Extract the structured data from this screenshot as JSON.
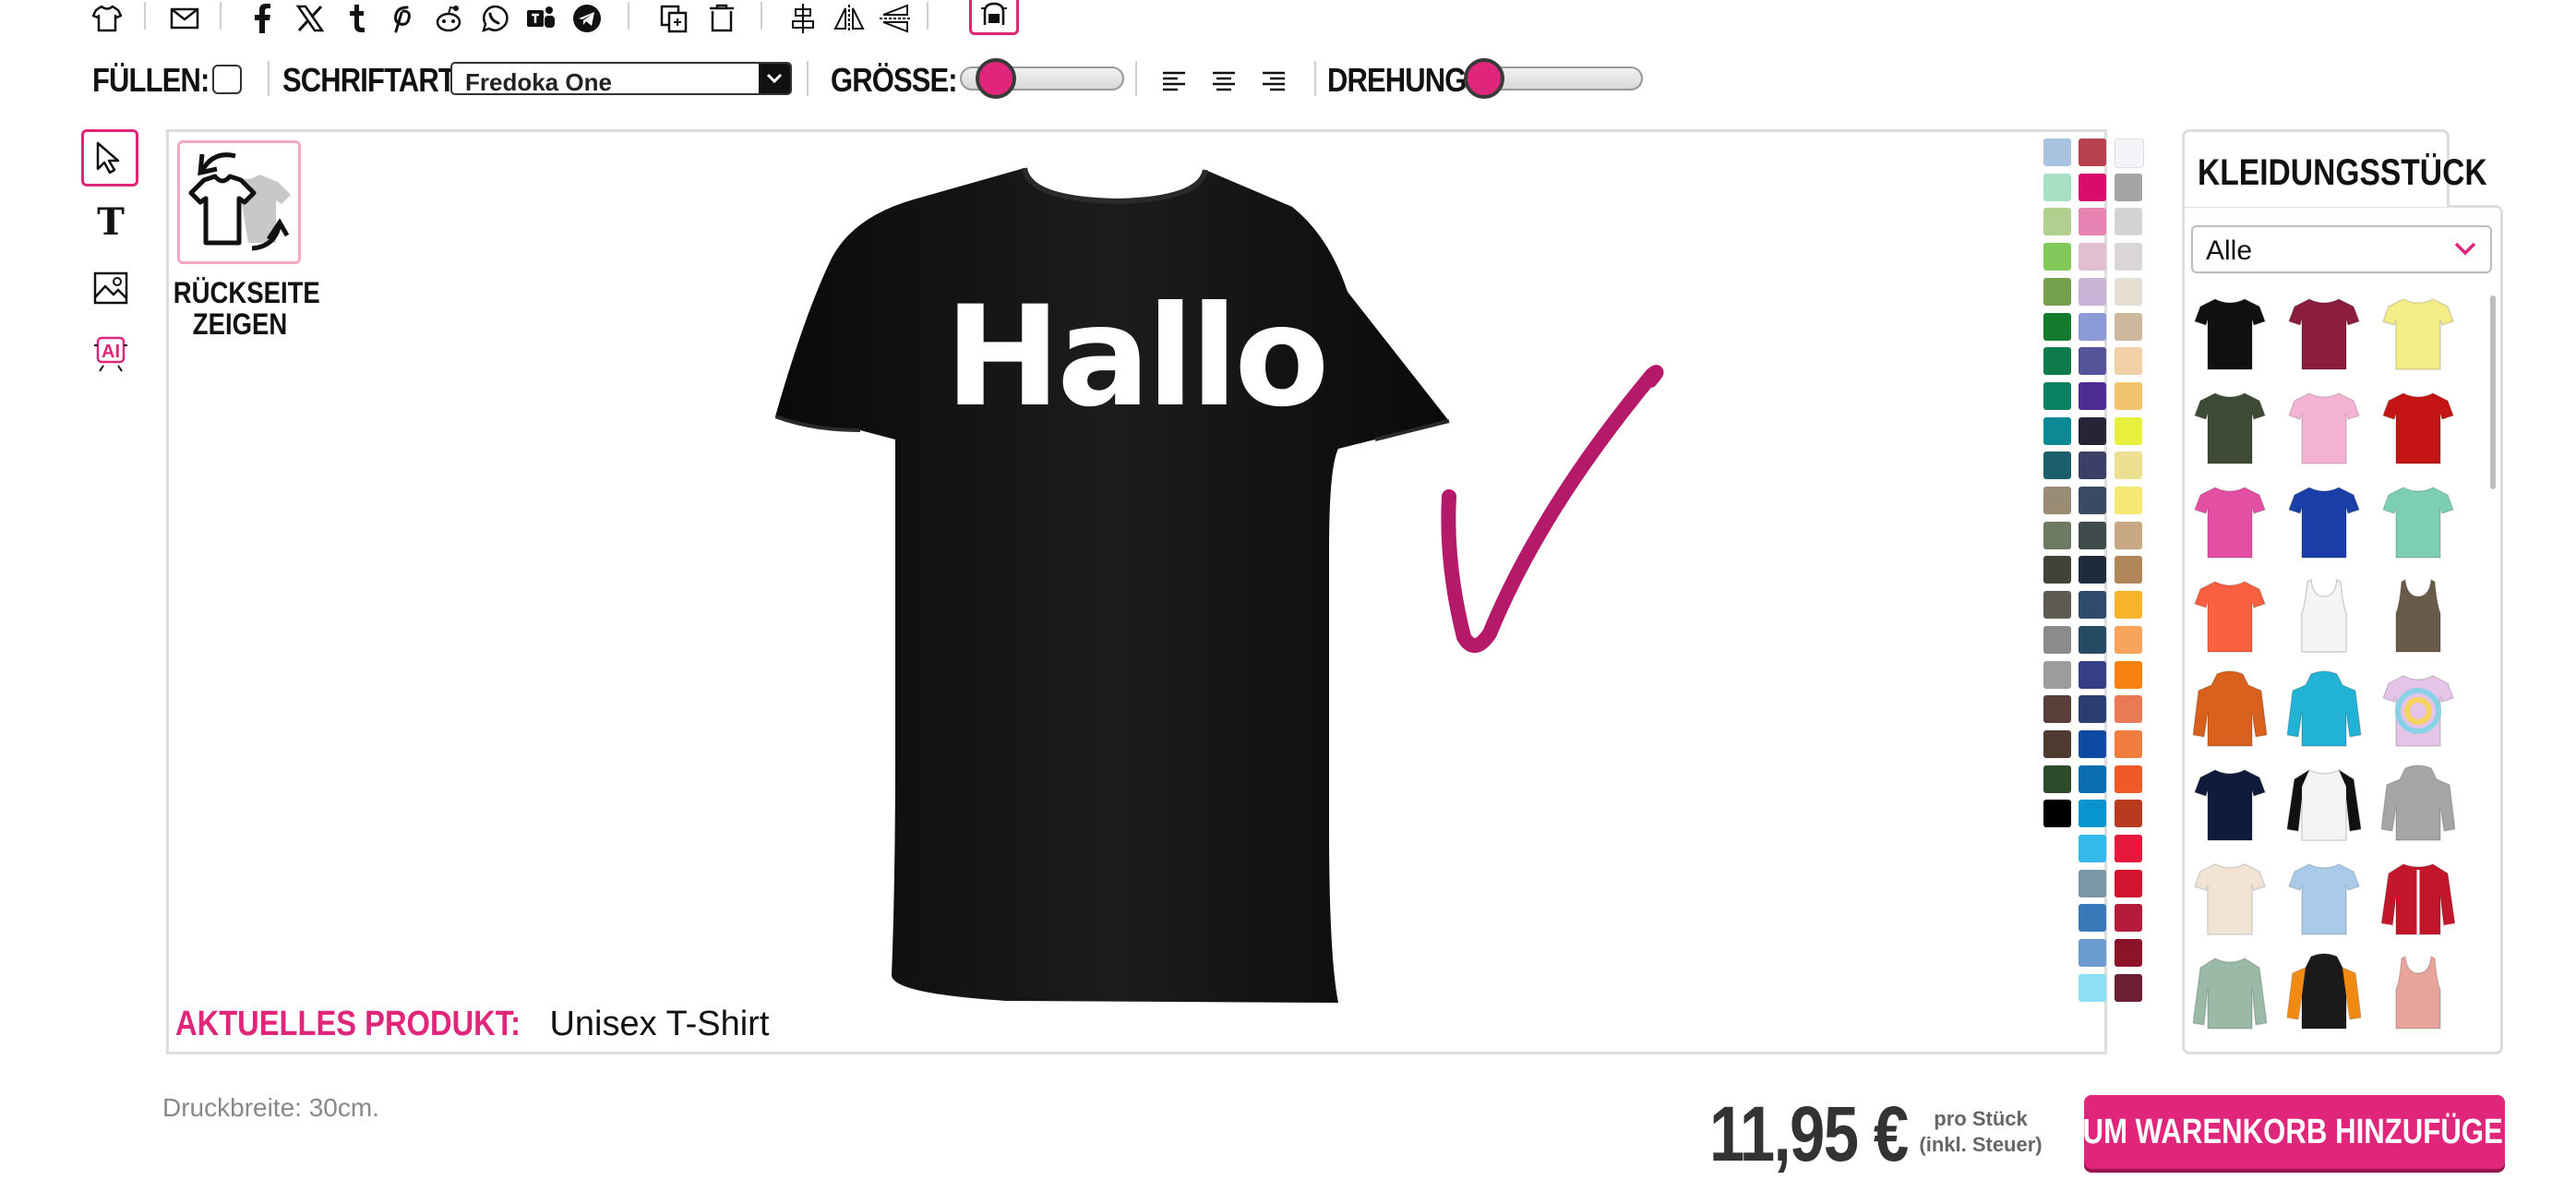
{
  "toolbar": {
    "fill_label": "FÜLLEN:",
    "font_label": "SCHRIFTART:",
    "font_value": "Fredoka One",
    "size_label": "GRÖSSE:",
    "size_level": 0.1,
    "rotation_label": "DREHUNG:",
    "rotation_level": 0.0
  },
  "top_icons": [
    "shirt-icon",
    "mail-icon",
    "facebook-icon",
    "x-icon",
    "tumblr-icon",
    "pinterest-icon",
    "reddit-icon",
    "whatsapp-icon",
    "teams-icon",
    "telegram-icon",
    "duplicate-icon",
    "trash-icon",
    "align-center-icon",
    "flip-horizontal-icon",
    "flip-vertical-icon",
    "mask-icon"
  ],
  "left_tools": [
    "select-tool-icon",
    "text-tool-icon",
    "image-tool-icon",
    "ai-tool-icon"
  ],
  "canvas": {
    "back_button_label": "RÜCKSEITE ZEIGEN",
    "shirt_text": "Hallo",
    "shirt_color": "#111111",
    "drawing_color": "#b5196a",
    "current_product_label": "AKTUELLES PRODUKT:",
    "current_product_value": "Unisex T-Shirt"
  },
  "color_swatches": {
    "col1": [
      "#a7c3df",
      "#a8e0c4",
      "#b1cf8e",
      "#82c95c",
      "#74a04f",
      "#157a2c",
      "#0f7a4a",
      "#0a8064",
      "#0b8a95",
      "#1b5f6d",
      "#9a8c74",
      "#6b7a60",
      "#404335",
      "#5d5a52",
      "#8b8b8b",
      "#9c9c9c",
      "#5a3e3a",
      "#4e3a2e",
      "#2d4a2a",
      "#000000"
    ],
    "col2": [
      "#b7414f",
      "#d80c6c",
      "#e783b3",
      "#e2bfd0",
      "#c9b3d6",
      "#8c9ad7",
      "#55549a",
      "#4d2d8f",
      "#272438",
      "#3b4066",
      "#3a4a63",
      "#3f4a4a",
      "#1f2a3a",
      "#2e4b6e",
      "#274a64",
      "#363e85",
      "#2a3e6f",
      "#0d4aa1",
      "#0b6db0",
      "#0895cf",
      "#35b8ea",
      "#7b96a7",
      "#3a78b9",
      "#6c9bd1",
      "#8fdff4"
    ],
    "col3": [
      "#f6f4f8",
      "#a4a4a4",
      "#d4d4d4",
      "#d9d6d5",
      "#e4dfd2",
      "#ccb89c",
      "#f1d0a8",
      "#f2c46f",
      "#e7f13d",
      "#ecdf8f",
      "#f5e873",
      "#c8a882",
      "#b0875a",
      "#f6b42b",
      "#f8a45a",
      "#f7810f",
      "#e97a55",
      "#ef7d3e",
      "#f05a26",
      "#b83b1f",
      "#e6193d",
      "#d2152e",
      "#b21b3a",
      "#8a1428",
      "#6a1f35"
    ]
  },
  "garment_panel": {
    "tab_label": "KLEIDUNGSSTÜCK",
    "filter_value": "Alle",
    "items": [
      {
        "name": "tshirt-black",
        "color": "#111111",
        "kind": "tee"
      },
      {
        "name": "tshirt-maroon",
        "color": "#8c1d3c",
        "kind": "tee"
      },
      {
        "name": "tshirt-yellow",
        "color": "#f4ee86",
        "kind": "tee"
      },
      {
        "name": "tshirt-olive",
        "color": "#3e4a34",
        "kind": "tee"
      },
      {
        "name": "tshirt-pink",
        "color": "#f5b3d3",
        "kind": "tee"
      },
      {
        "name": "tshirt-red",
        "color": "#c41414",
        "kind": "tee"
      },
      {
        "name": "tshirt-fuchsia",
        "color": "#e24fa3",
        "kind": "tee"
      },
      {
        "name": "tshirt-royal",
        "color": "#1b3fa8",
        "kind": "tee"
      },
      {
        "name": "tshirt-mint",
        "color": "#7ccfb0",
        "kind": "tee"
      },
      {
        "name": "tshirt-coral",
        "color": "#f8603f",
        "kind": "tee"
      },
      {
        "name": "tanktop-white",
        "color": "#f5f5f5",
        "kind": "tank"
      },
      {
        "name": "tanktop-brown",
        "color": "#6a5a4a",
        "kind": "tank"
      },
      {
        "name": "hoodie-orange",
        "color": "#d8611d",
        "kind": "hoodie"
      },
      {
        "name": "hoodie-cyan",
        "color": "#22b2d6",
        "kind": "hoodie"
      },
      {
        "name": "tshirt-tiedye",
        "color": "#e5c4e8",
        "kind": "tee"
      },
      {
        "name": "tshirt-navy",
        "color": "#101a3a",
        "kind": "tee"
      },
      {
        "name": "raglan-black-white",
        "color": "#f4f4f4",
        "kind": "raglan"
      },
      {
        "name": "hoodie-grey",
        "color": "#a5a5a5",
        "kind": "hoodie"
      },
      {
        "name": "tshirt-cream",
        "color": "#f2e3d2",
        "kind": "tee"
      },
      {
        "name": "tshirt-lightblue",
        "color": "#a9cbe9",
        "kind": "tee"
      },
      {
        "name": "jacket-red",
        "color": "#c4162a",
        "kind": "jacket"
      },
      {
        "name": "longsleeve-sage",
        "color": "#9ab9a6",
        "kind": "long"
      },
      {
        "name": "hoodie-black-orange",
        "color": "#1a1a1a",
        "kind": "hoodie"
      },
      {
        "name": "tanktop-rose",
        "color": "#e8a39b",
        "kind": "tank"
      }
    ]
  },
  "footer": {
    "print_width": "Druckbreite: 30cm.",
    "price": "11,95 €",
    "per_unit_line1": "pro Stück",
    "per_unit_line2": "(inkl. Steuer)",
    "cart_button": "ZUM WARENKORB HINZUFÜGEN"
  }
}
